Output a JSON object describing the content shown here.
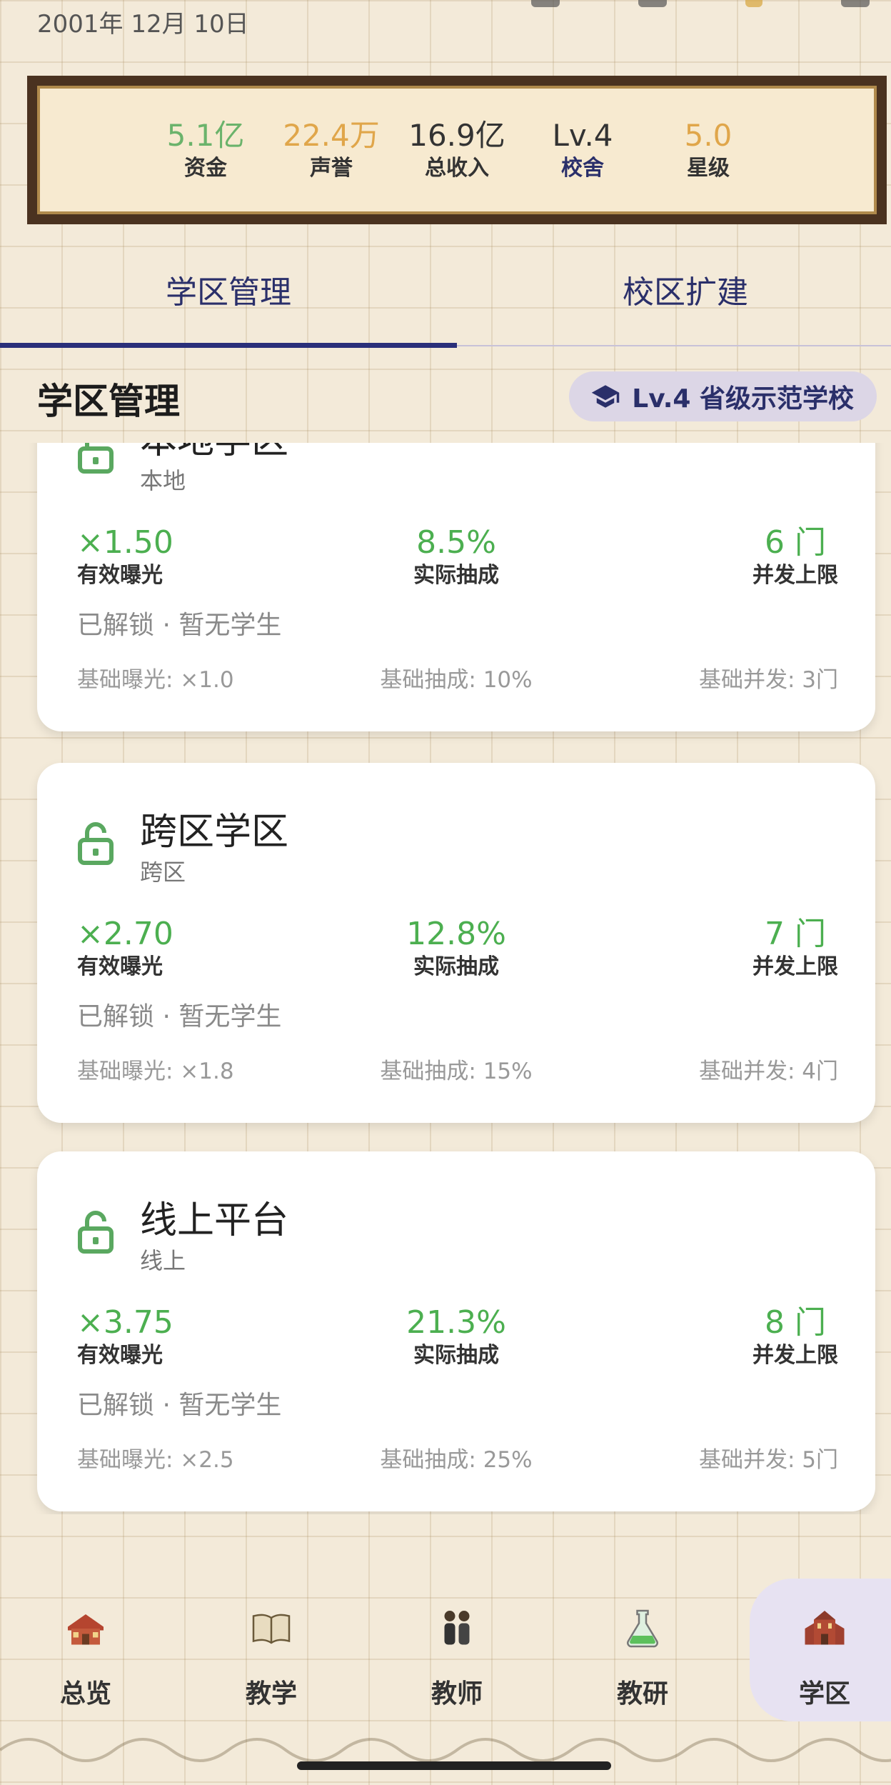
{
  "date": "2001年 12月 10日",
  "stats": [
    {
      "value": "5.1亿",
      "label": "资金",
      "color": "#6bb36b",
      "label_color": "#333"
    },
    {
      "value": "22.4万",
      "label": "声誉",
      "color": "#e0a64a",
      "label_color": "#333"
    },
    {
      "value": "16.9亿",
      "label": "总收入",
      "color": "#333333",
      "label_color": "#333"
    },
    {
      "value": "Lv.4",
      "label": "校舍",
      "color": "#333333",
      "label_color": "#2a2f6a"
    },
    {
      "value": "5.0",
      "label": "星级",
      "color": "#e0a64a",
      "label_color": "#333"
    }
  ],
  "tabs": [
    {
      "label": "学区管理",
      "active": true
    },
    {
      "label": "校区扩建",
      "active": false
    }
  ],
  "section": {
    "title": "学区管理",
    "badge": "Lv.4 省级示范学校"
  },
  "cards": [
    {
      "title": "本地学区",
      "subtitle": "本地",
      "exposure": "×1.50",
      "exposure_label": "有效曝光",
      "rate": "8.5%",
      "rate_label": "实际抽成",
      "limit": "6 门",
      "limit_label": "并发上限",
      "status": "已解锁 · 暂无学生",
      "base_exposure": "基础曝光: ×1.0",
      "base_rate": "基础抽成: 10%",
      "base_limit": "基础并发: 3门"
    },
    {
      "title": "跨区学区",
      "subtitle": "跨区",
      "exposure": "×2.70",
      "exposure_label": "有效曝光",
      "rate": "12.8%",
      "rate_label": "实际抽成",
      "limit": "7 门",
      "limit_label": "并发上限",
      "status": "已解锁 · 暂无学生",
      "base_exposure": "基础曝光: ×1.8",
      "base_rate": "基础抽成: 15%",
      "base_limit": "基础并发: 4门"
    },
    {
      "title": "线上平台",
      "subtitle": "线上",
      "exposure": "×3.75",
      "exposure_label": "有效曝光",
      "rate": "21.3%",
      "rate_label": "实际抽成",
      "limit": "8 门",
      "limit_label": "并发上限",
      "status": "已解锁 · 暂无学生",
      "base_exposure": "基础曝光: ×2.5",
      "base_rate": "基础抽成: 25%",
      "base_limit": "基础并发: 5门"
    }
  ],
  "nav": [
    {
      "label": "总览",
      "icon": "school-house-icon",
      "active": false
    },
    {
      "label": "教学",
      "icon": "open-book-icon",
      "active": false
    },
    {
      "label": "教师",
      "icon": "teachers-icon",
      "active": false
    },
    {
      "label": "教研",
      "icon": "flask-icon",
      "active": false
    },
    {
      "label": "学区",
      "icon": "campus-building-icon",
      "active": true
    }
  ],
  "colors": {
    "accent": "#2a2f6a",
    "green": "#4caf50",
    "frame": "#4a3220",
    "background": "#f3ead9"
  }
}
